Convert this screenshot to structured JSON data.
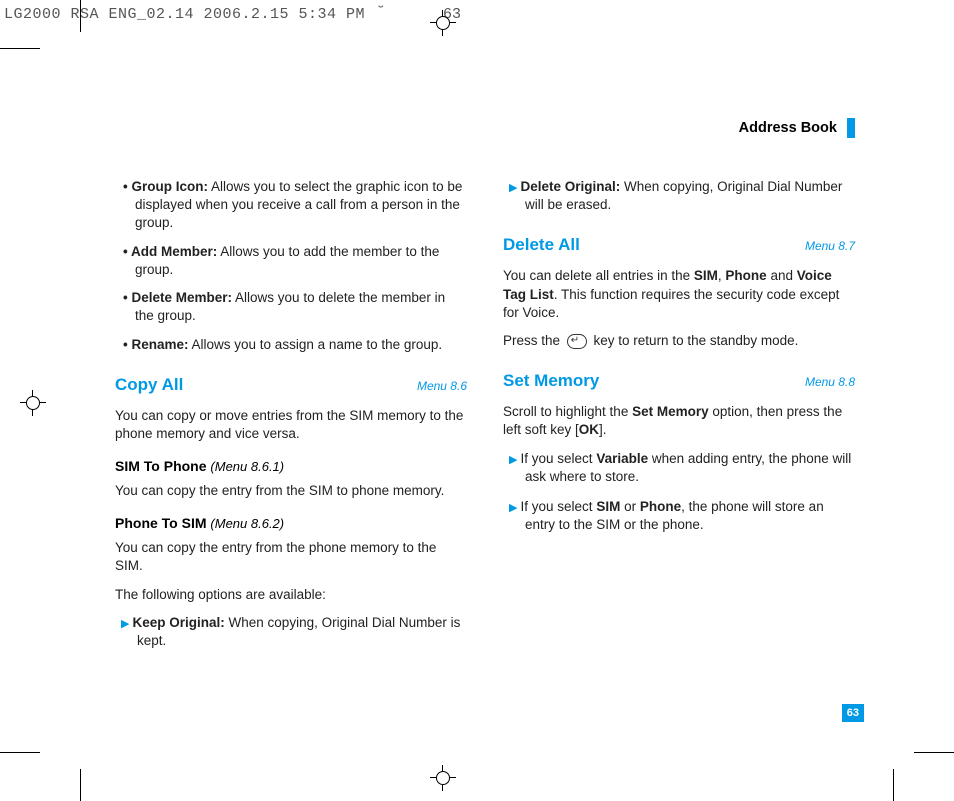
{
  "meta": {
    "file_stamp": "LG2000 RSA ENG_02.14  2006.2.15 5:34 PM",
    "header_glyph": "˘",
    "header_pagenum": "63"
  },
  "header": {
    "section": "Address Book"
  },
  "col_left": {
    "bullets": [
      {
        "label": "Group Icon:",
        "text": " Allows you to select the graphic icon to be displayed when you receive a call from a person in the group."
      },
      {
        "label": "Add Member:",
        "text": " Allows you to add the member to the group."
      },
      {
        "label": "Delete Member:",
        "text": " Allows you to delete the member in the group."
      },
      {
        "label": "Rename:",
        "text": " Allows you to assign a name to the group."
      }
    ],
    "copy_all": {
      "title": "Copy All",
      "menu": "Menu 8.6",
      "intro": "You can copy or move entries from the SIM memory to the phone memory and vice versa.",
      "sim_to_phone": {
        "title": "SIM To Phone",
        "menu": "(Menu 8.6.1)",
        "text": "You can copy the entry from the SIM to phone memory."
      },
      "phone_to_sim": {
        "title": "Phone To SIM",
        "menu": "(Menu 8.6.2)",
        "text": "You can copy the entry from the phone memory to the SIM.",
        "options_intro": "The following options are available:",
        "keep_label": "Keep Original:",
        "keep_text": " When copying, Original Dial Number is kept."
      }
    }
  },
  "col_right": {
    "delete_original": {
      "label": "Delete Original:",
      "text": " When copying, Original Dial Number will be erased."
    },
    "delete_all": {
      "title": "Delete All",
      "menu": "Menu 8.7",
      "p1_pre": "You can delete all entries in the ",
      "p1_sim": "SIM",
      "p1_c1": ", ",
      "p1_phone": "Phone",
      "p1_c2": " and ",
      "p1_vtl": "Voice Tag List",
      "p1_post": ". This function requires the security code except for Voice.",
      "p2_pre": "Press the ",
      "p2_post": " key to return to the standby mode."
    },
    "set_memory": {
      "title": "Set Memory",
      "menu": "Menu 8.8",
      "intro_pre": "Scroll to highlight the ",
      "intro_b": "Set Memory",
      "intro_mid": " option, then press the left soft key [",
      "intro_ok": "OK",
      "intro_post": "].",
      "opt1_pre": "If you select ",
      "opt1_b": "Variable",
      "opt1_post": " when adding entry, the phone will ask where to store.",
      "opt2_pre": "If you select ",
      "opt2_b1": "SIM",
      "opt2_mid": " or ",
      "opt2_b2": "Phone",
      "opt2_post": ", the phone will store an entry to the SIM or the phone."
    }
  },
  "page_number": "63"
}
